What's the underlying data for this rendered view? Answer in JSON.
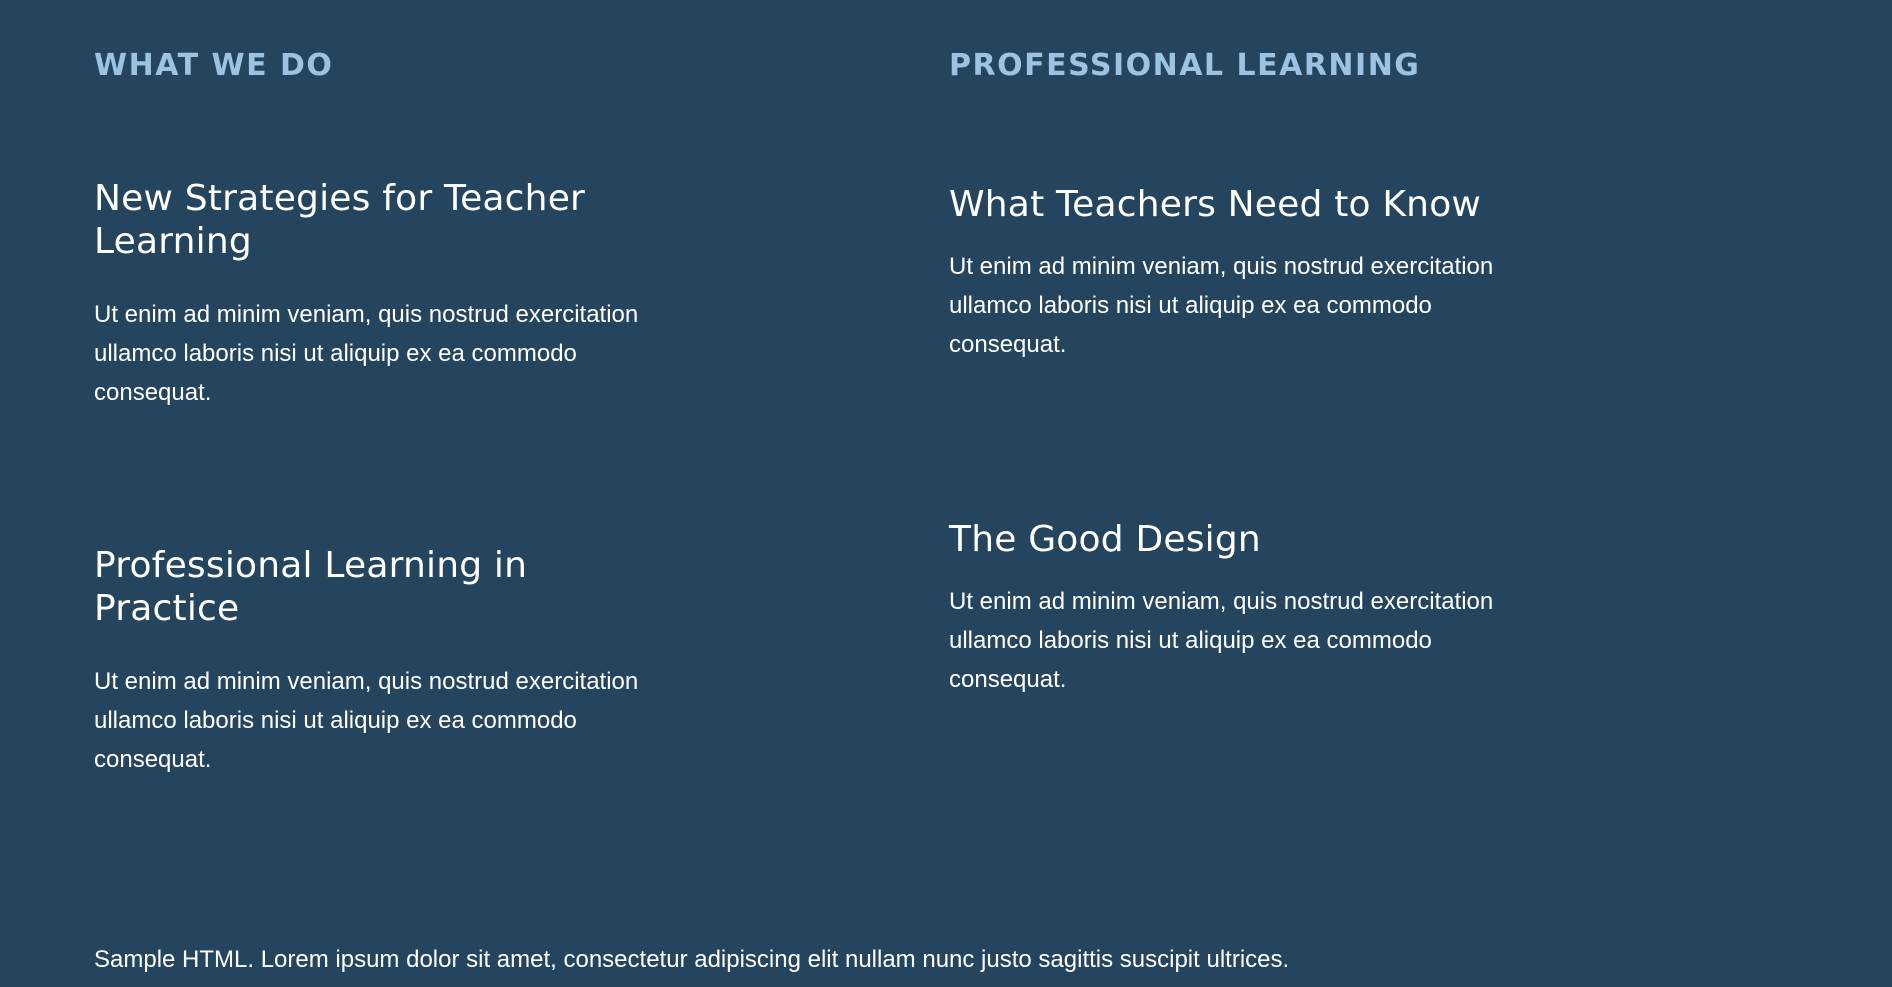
{
  "sections": {
    "left": {
      "heading": "WHAT WE DO",
      "articles": [
        {
          "title": "New Strategies for Teacher Learning",
          "body": "Ut enim ad minim veniam, quis nostrud exercitation ullamco laboris nisi ut aliquip ex ea commodo consequat."
        },
        {
          "title": "Professional Learning in Practice",
          "body": "Ut enim ad minim veniam, quis nostrud exercitation ullamco laboris nisi ut aliquip ex ea commodo consequat."
        }
      ]
    },
    "right": {
      "heading": "PROFESSIONAL LEARNING",
      "articles": [
        {
          "title": "What Teachers Need to Know",
          "body": "Ut enim ad minim veniam, quis nostrud exercitation ullamco laboris nisi ut aliquip ex ea commodo consequat."
        },
        {
          "title": "The Good Design",
          "body": "Ut enim ad minim veniam, quis nostrud exercitation ullamco laboris nisi ut aliquip ex ea commodo consequat."
        }
      ]
    }
  },
  "footer": {
    "text": "Sample HTML. Lorem ipsum dolor sit amet, consectetur adipiscing elit nullam nunc justo sagittis suscipit ultrices."
  },
  "colors": {
    "background": "#24455d",
    "heading_accent": "#9cc3e2",
    "text": "#ffffff"
  }
}
